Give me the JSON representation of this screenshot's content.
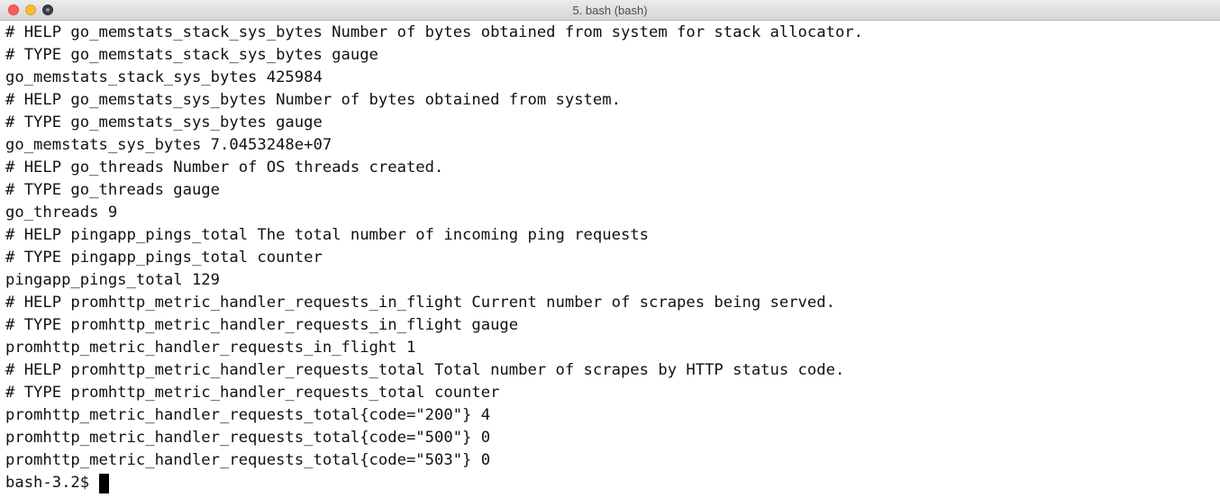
{
  "window": {
    "title": "5. bash (bash)"
  },
  "terminal": {
    "lines": [
      "# HELP go_memstats_stack_sys_bytes Number of bytes obtained from system for stack allocator.",
      "# TYPE go_memstats_stack_sys_bytes gauge",
      "go_memstats_stack_sys_bytes 425984",
      "# HELP go_memstats_sys_bytes Number of bytes obtained from system.",
      "# TYPE go_memstats_sys_bytes gauge",
      "go_memstats_sys_bytes 7.0453248e+07",
      "# HELP go_threads Number of OS threads created.",
      "# TYPE go_threads gauge",
      "go_threads 9",
      "# HELP pingapp_pings_total The total number of incoming ping requests",
      "# TYPE pingapp_pings_total counter",
      "pingapp_pings_total 129",
      "# HELP promhttp_metric_handler_requests_in_flight Current number of scrapes being served.",
      "# TYPE promhttp_metric_handler_requests_in_flight gauge",
      "promhttp_metric_handler_requests_in_flight 1",
      "# HELP promhttp_metric_handler_requests_total Total number of scrapes by HTTP status code.",
      "# TYPE promhttp_metric_handler_requests_total counter",
      "promhttp_metric_handler_requests_total{code=\"200\"} 4",
      "promhttp_metric_handler_requests_total{code=\"500\"} 0",
      "promhttp_metric_handler_requests_total{code=\"503\"} 0"
    ],
    "prompt": "bash-3.2$"
  },
  "colors": {
    "close": "#fc5f57",
    "minimize": "#fdbc2e",
    "zoom_inactive": "#3a3f4a",
    "text": "#111111",
    "background": "#ffffff"
  },
  "icons": {
    "close": "close-button",
    "minimize": "minimize-button",
    "zoom": "zoom-button"
  }
}
